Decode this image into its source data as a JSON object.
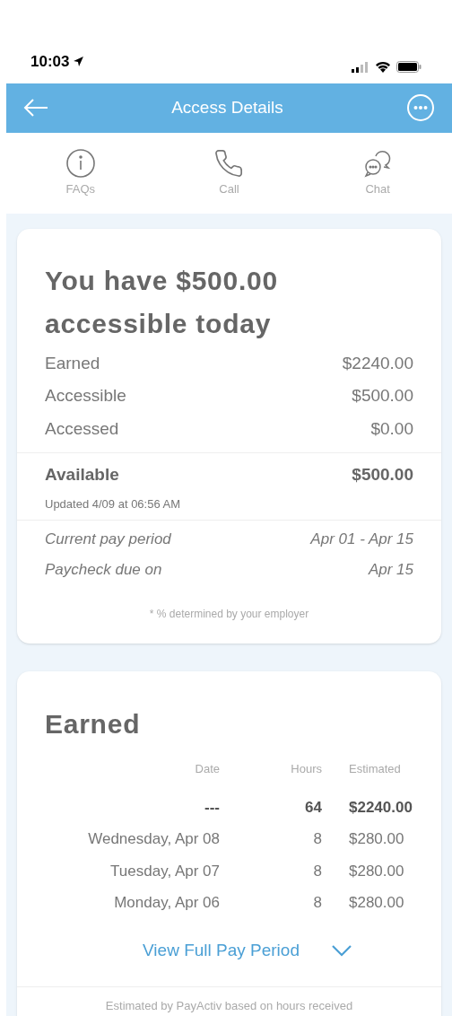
{
  "status_bar": {
    "time": "10:03"
  },
  "header": {
    "title": "Access Details"
  },
  "actions": [
    {
      "kind": "info",
      "label": "FAQs"
    },
    {
      "kind": "phone",
      "label": "Call"
    },
    {
      "kind": "chat",
      "label": "Chat"
    }
  ],
  "summary": {
    "headline": "You have $500.00 accessible today",
    "lines": [
      {
        "label": "Earned",
        "value": "$2240.00"
      },
      {
        "label": "Accessible",
        "value": "$500.00"
      },
      {
        "label": "Accessed",
        "value": "$0.00"
      }
    ],
    "available": {
      "label": "Available",
      "value": "$500.00"
    },
    "updated": "Updated 4/09 at 06:56 AM",
    "period": [
      {
        "label": "Current pay period",
        "value": "Apr 01 - Apr 15"
      },
      {
        "label": "Paycheck due on",
        "value": "Apr 15"
      }
    ],
    "note": "* % determined by your employer"
  },
  "earned": {
    "title": "Earned",
    "columns": [
      "Date",
      "Hours",
      "Estimated"
    ],
    "rows": [
      {
        "date": "---",
        "hours": "64",
        "estimated": "$2240.00",
        "total": true
      },
      {
        "date": "Wednesday, Apr 08",
        "hours": "8",
        "estimated": "$280.00",
        "total": false
      },
      {
        "date": "Tuesday, Apr 07",
        "hours": "8",
        "estimated": "$280.00",
        "total": false
      },
      {
        "date": "Monday, Apr 06",
        "hours": "8",
        "estimated": "$280.00",
        "total": false
      }
    ],
    "link": "View Full Pay Period",
    "footnote": "Estimated by PayActiv based on hours received"
  }
}
